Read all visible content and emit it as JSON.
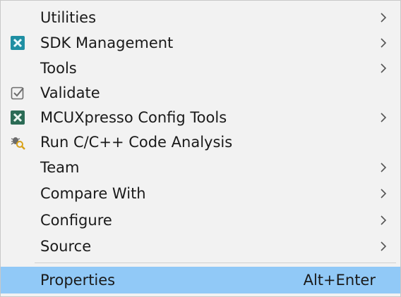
{
  "menu": {
    "items": [
      {
        "label": "Utilities",
        "submenu": true,
        "icon": ""
      },
      {
        "label": "SDK Management",
        "submenu": true,
        "icon": "sdk-management-icon"
      },
      {
        "label": "Tools",
        "submenu": true,
        "icon": ""
      },
      {
        "label": "Validate",
        "submenu": false,
        "icon": "validate-checkbox-icon"
      },
      {
        "label": "MCUXpresso Config Tools",
        "submenu": true,
        "icon": "mcuxpresso-config-icon"
      },
      {
        "label": "Run C/C++ Code Analysis",
        "submenu": false,
        "icon": "code-analysis-bug-icon"
      },
      {
        "label": "Team",
        "submenu": true,
        "icon": ""
      },
      {
        "label": "Compare With",
        "submenu": true,
        "icon": ""
      },
      {
        "label": "Configure",
        "submenu": true,
        "icon": ""
      },
      {
        "label": "Source",
        "submenu": true,
        "icon": ""
      },
      {
        "label": "Properties",
        "shortcut": "Alt+Enter",
        "submenu": false,
        "icon": "",
        "selected": true
      }
    ]
  },
  "colors": {
    "menu_background": "#f2f2f2",
    "selection_highlight": "#91c9f7",
    "sdk_icon": "#1f8fa3",
    "config_icon": "#2b6b55"
  }
}
